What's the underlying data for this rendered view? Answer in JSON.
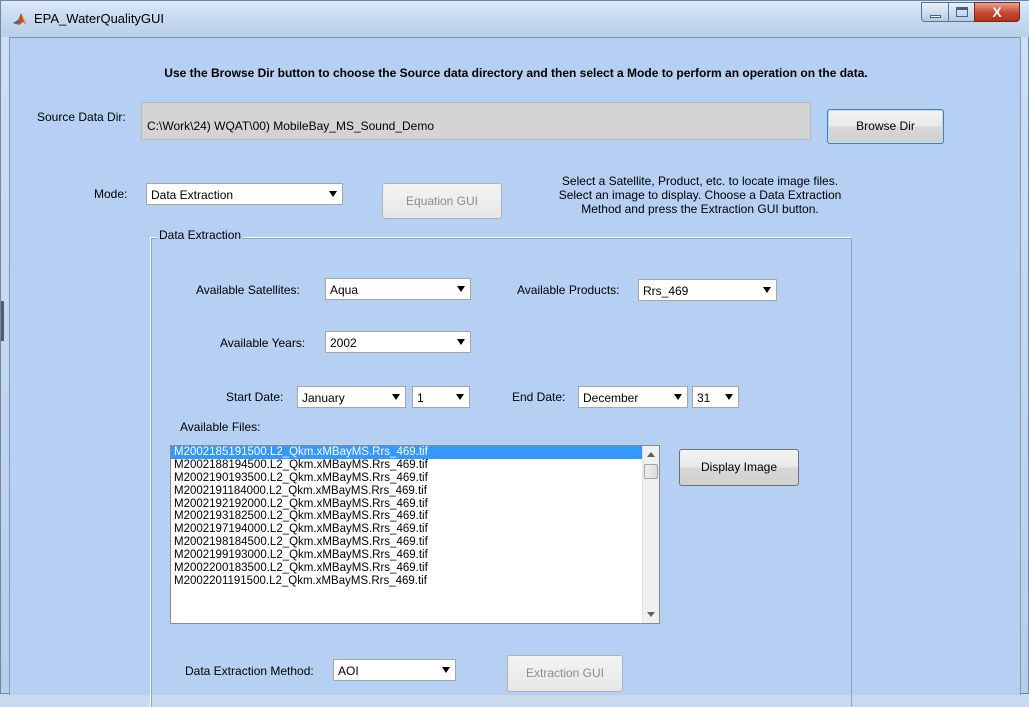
{
  "window": {
    "title": "EPA_WaterQualityGUI",
    "close_glyph": "X"
  },
  "instructions": "Use the Browse Dir button to choose the Source data directory and then select a Mode to perform an operation on the data.",
  "source": {
    "label": "Source Data Dir:",
    "value": "C:\\Work\\24) WQAT\\00) MobileBay_MS_Sound_Demo",
    "browse_label": "Browse Dir"
  },
  "mode": {
    "label": "Mode:",
    "selected": "Data Extraction",
    "equation_gui_label": "Equation GUI",
    "help_text_lines": [
      "Select a Satellite, Product, etc. to locate image files.",
      "Select an image to display. Choose a Data Extraction",
      "Method and press the Extraction GUI button."
    ]
  },
  "extraction_panel": {
    "title": "Data Extraction",
    "satellites_label": "Available Satellites:",
    "satellite": "Aqua",
    "products_label": "Available Products:",
    "product": "Rrs_469",
    "years_label": "Available Years:",
    "year": "2002",
    "start_date_label": "Start Date:",
    "start_month": "January",
    "start_day": "1",
    "end_date_label": "End Date:",
    "end_month": "December",
    "end_day": "31",
    "files_label": "Available Files:",
    "files": [
      "M2002185191500.L2_Qkm.xMBayMS.Rrs_469.tif",
      "M2002188194500.L2_Qkm.xMBayMS.Rrs_469.tif",
      "M2002190193500.L2_Qkm.xMBayMS.Rrs_469.tif",
      "M2002191184000.L2_Qkm.xMBayMS.Rrs_469.tif",
      "M2002192192000.L2_Qkm.xMBayMS.Rrs_469.tif",
      "M2002193182500.L2_Qkm.xMBayMS.Rrs_469.tif",
      "M2002197194000.L2_Qkm.xMBayMS.Rrs_469.tif",
      "M2002198184500.L2_Qkm.xMBayMS.Rrs_469.tif",
      "M2002199193000.L2_Qkm.xMBayMS.Rrs_469.tif",
      "M2002200183500.L2_Qkm.xMBayMS.Rrs_469.tif",
      "M2002201191500.L2_Qkm.xMBayMS.Rrs_469.tif"
    ],
    "selected_file_index": 0,
    "display_image_label": "Display Image",
    "method_label": "Data Extraction Method:",
    "method": "AOI",
    "extraction_gui_label": "Extraction GUI"
  },
  "colors": {
    "client_bg": "#b5d0f2",
    "selection": "#3399ff"
  }
}
